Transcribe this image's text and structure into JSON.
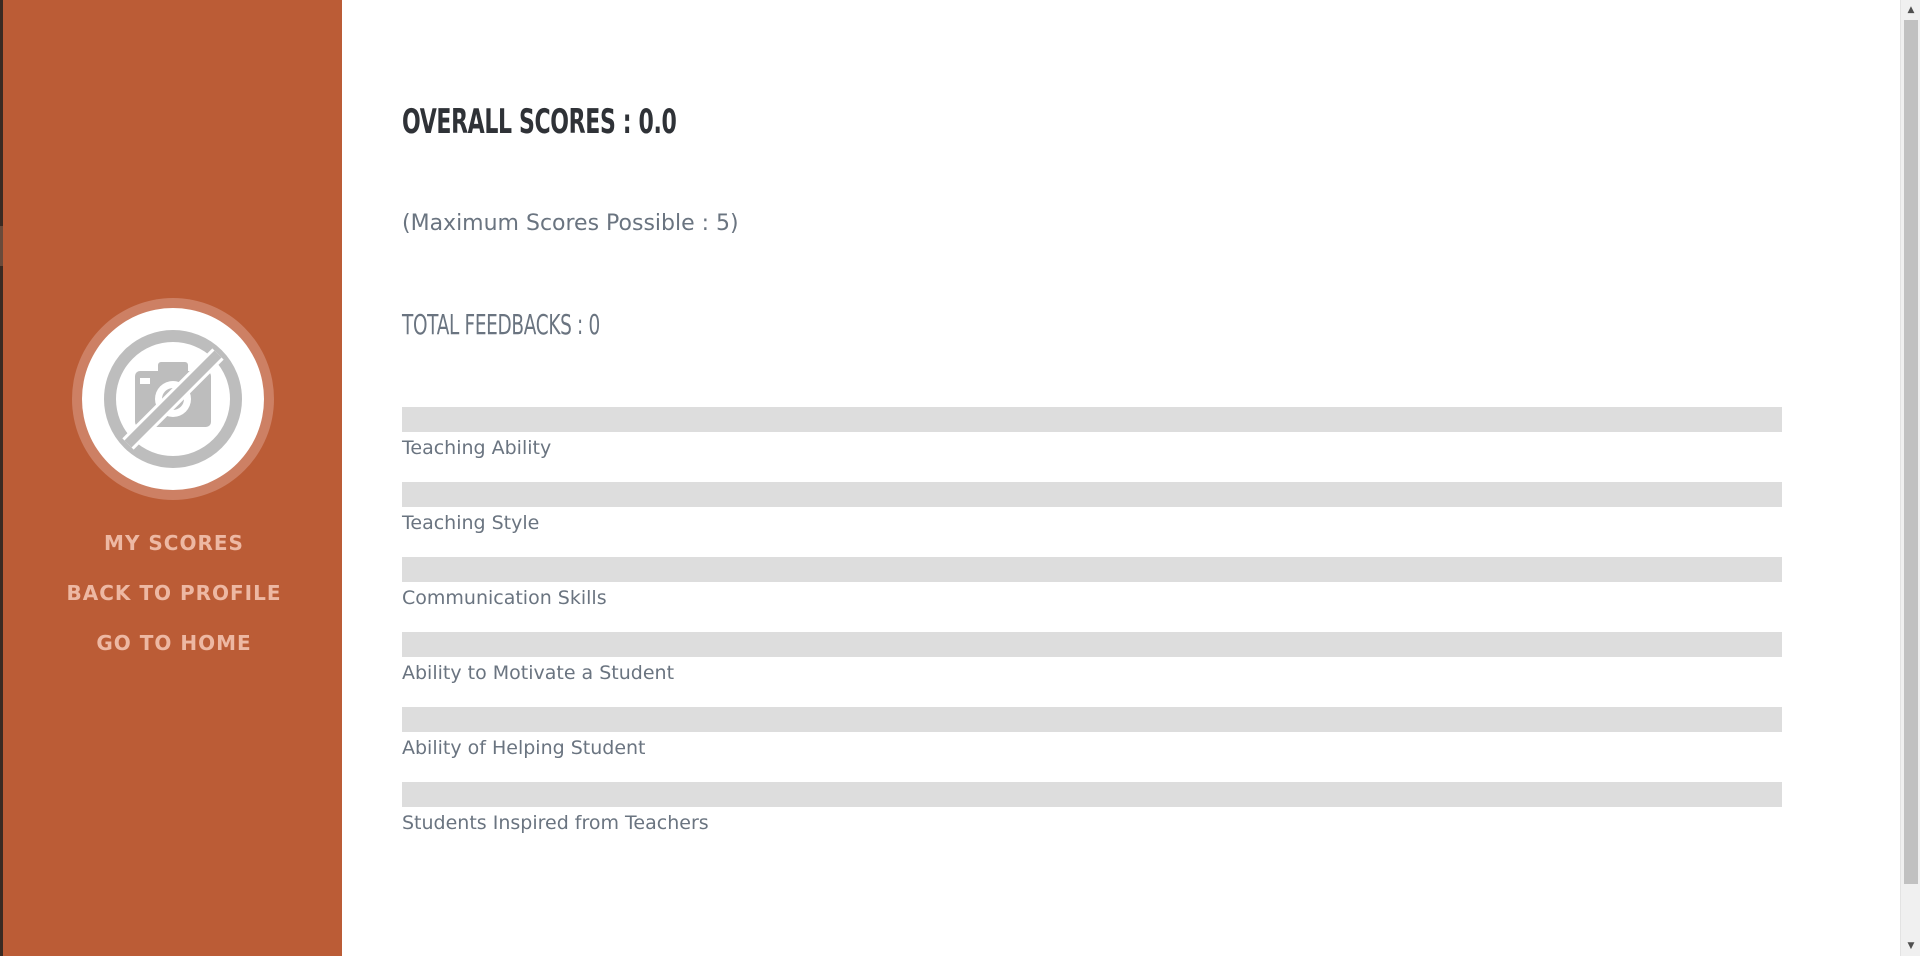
{
  "sidebar": {
    "avatar_icon": "no-camera-icon",
    "nav": [
      {
        "label": "MY SCORES"
      },
      {
        "label": "BACK TO PROFILE"
      },
      {
        "label": "GO TO HOME"
      }
    ]
  },
  "main": {
    "overall_scores": "OVERALL SCORES : 0.0",
    "max_note": "(Maximum Scores Possible : 5)",
    "total_feedbacks": "TOTAL FEEDBACKS : 0",
    "metrics": [
      {
        "label": "Teaching Ability",
        "score": 0,
        "max": 5
      },
      {
        "label": "Teaching Style",
        "score": 0,
        "max": 5
      },
      {
        "label": "Communication Skills",
        "score": 0,
        "max": 5
      },
      {
        "label": "Ability to Motivate a Student",
        "score": 0,
        "max": 5
      },
      {
        "label": "Ability of Helping Student",
        "score": 0,
        "max": 5
      },
      {
        "label": "Students Inspired from Teachers",
        "score": 0,
        "max": 5
      }
    ]
  },
  "colors": {
    "sidebar_bg": "#bb5c36",
    "nav_text": "#edb8a3",
    "bar_track": "#dddddd",
    "heading": "#2f3237",
    "body_text": "#6a7480"
  }
}
